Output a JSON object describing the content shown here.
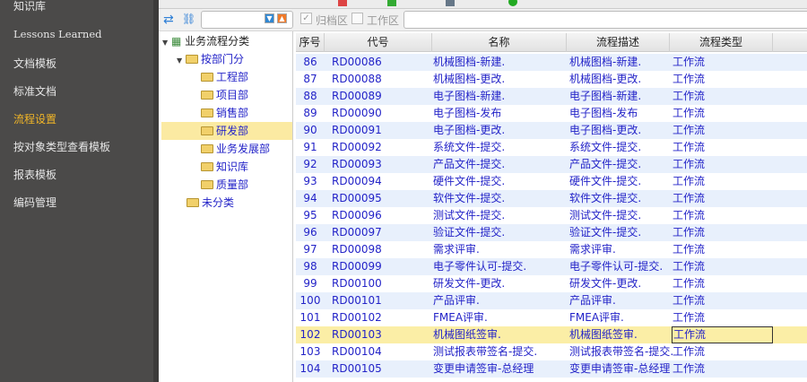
{
  "sidebar": {
    "items": [
      {
        "label": "知识库"
      },
      {
        "label": "Lessons Learned"
      },
      {
        "label": "文档模板"
      },
      {
        "label": "标准文档"
      },
      {
        "label": "流程设置",
        "active": true
      },
      {
        "label": "按对象类型查看模板"
      },
      {
        "label": "报表模板"
      },
      {
        "label": "编码管理"
      }
    ]
  },
  "toolbar": {
    "archive_label": "归档区",
    "archive_checked": true,
    "work_label": "工作区",
    "work_checked": false,
    "search_value": "",
    "filter_value": ""
  },
  "tree": {
    "root": "业务流程分类",
    "group": "按部门分",
    "departments": [
      "工程部",
      "项目部",
      "销售部",
      "研发部",
      "业务发展部",
      "知识库",
      "质量部"
    ],
    "selected": "研发部",
    "uncategorized": "未分类"
  },
  "grid": {
    "columns": [
      "序号",
      "代号",
      "名称",
      "流程描述",
      "流程类型"
    ],
    "rows": [
      [
        "86",
        "RD00086",
        "机械图档-新建.",
        "机械图档-新建.",
        "工作流"
      ],
      [
        "87",
        "RD00088",
        "机械图档-更改.",
        "机械图档-更改.",
        "工作流"
      ],
      [
        "88",
        "RD00089",
        "电子图档-新建.",
        "电子图档-新建.",
        "工作流"
      ],
      [
        "89",
        "RD00090",
        "电子图档-发布",
        "电子图档-发布",
        "工作流"
      ],
      [
        "90",
        "RD00091",
        "电子图档-更改.",
        "电子图档-更改.",
        "工作流"
      ],
      [
        "91",
        "RD00092",
        "系统文件-提交.",
        "系统文件-提交.",
        "工作流"
      ],
      [
        "92",
        "RD00093",
        "产品文件-提交.",
        "产品文件-提交.",
        "工作流"
      ],
      [
        "93",
        "RD00094",
        "硬件文件-提交.",
        "硬件文件-提交.",
        "工作流"
      ],
      [
        "94",
        "RD00095",
        "软件文件-提交.",
        "软件文件-提交.",
        "工作流"
      ],
      [
        "95",
        "RD00096",
        "测试文件-提交.",
        "测试文件-提交.",
        "工作流"
      ],
      [
        "96",
        "RD00097",
        "验证文件-提交.",
        "验证文件-提交.",
        "工作流"
      ],
      [
        "97",
        "RD00098",
        "需求评审.",
        "需求评审.",
        "工作流"
      ],
      [
        "98",
        "RD00099",
        "电子零件认可-提交.",
        "电子零件认可-提交.",
        "工作流"
      ],
      [
        "99",
        "RD00100",
        "研发文件-更改.",
        "研发文件-更改.",
        "工作流"
      ],
      [
        "100",
        "RD00101",
        "产品评审.",
        "产品评审.",
        "工作流"
      ],
      [
        "101",
        "RD00102",
        "FMEA评审.",
        "FMEA评审.",
        "工作流"
      ],
      [
        "102",
        "RD00103",
        "机械图纸签审.",
        "机械图纸签审.",
        "工作流"
      ],
      [
        "103",
        "RD00104",
        "测试报表带签名-提交.",
        "测试报表带签名-提交.",
        "工作流"
      ],
      [
        "104",
        "RD00105",
        "变更申请签审-总经理",
        "变更申请签审-总经理",
        "工作流"
      ]
    ],
    "selected_row": 16
  }
}
